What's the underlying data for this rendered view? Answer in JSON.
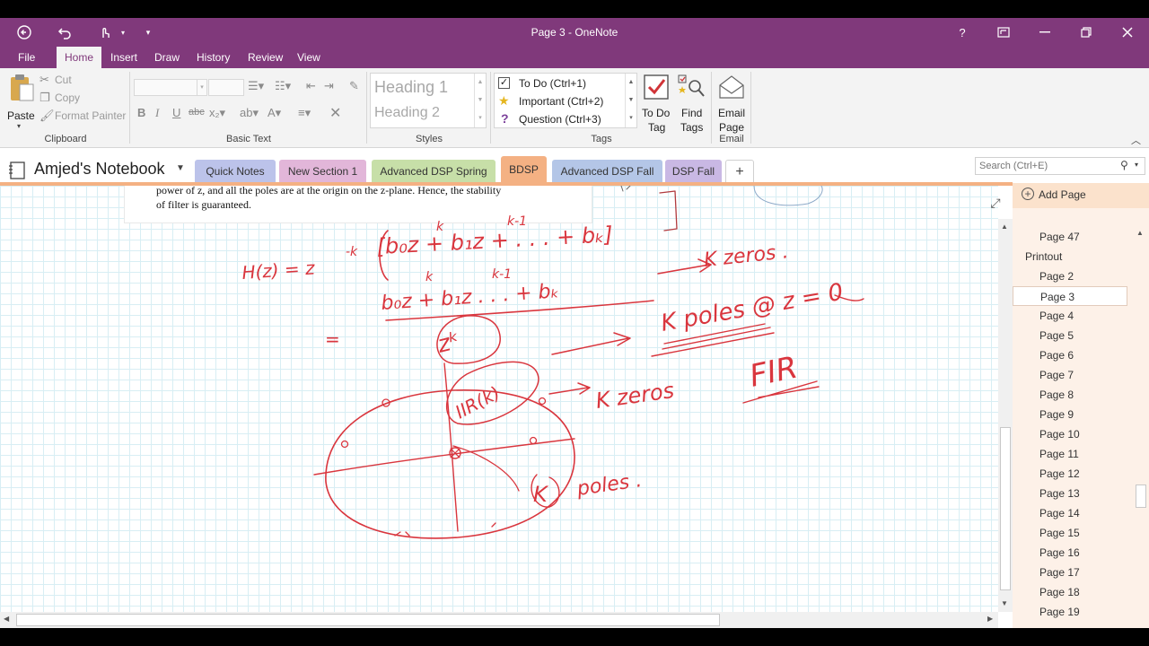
{
  "window": {
    "title": "Page 3 - OneNote",
    "help": "?"
  },
  "menu": {
    "tabs": [
      "File",
      "Home",
      "Insert",
      "Draw",
      "History",
      "Review",
      "View"
    ],
    "active": "Home"
  },
  "ribbon": {
    "clipboard": {
      "paste": "Paste",
      "cut": "Cut",
      "copy": "Copy",
      "format_painter": "Format Painter",
      "label": "Clipboard"
    },
    "basic_text": {
      "label": "Basic Text"
    },
    "styles": {
      "heading1": "Heading 1",
      "heading2": "Heading 2",
      "label": "Styles"
    },
    "tags": {
      "items": [
        "To Do (Ctrl+1)",
        "Important (Ctrl+2)",
        "Question (Ctrl+3)"
      ],
      "todo_tag_line1": "To Do",
      "todo_tag_line2": "Tag",
      "find_tags_line1": "Find",
      "find_tags_line2": "Tags",
      "label": "Tags"
    },
    "email": {
      "line1": "Email",
      "line2": "Page",
      "label": "Email"
    }
  },
  "notebook": {
    "name": "Amjed's Notebook",
    "sections": [
      {
        "label": "Quick Notes",
        "color": "#bcc3ea"
      },
      {
        "label": "New Section 1",
        "color": "#e2b6d9"
      },
      {
        "label": "Advanced DSP Spring",
        "color": "#c7dfa8"
      },
      {
        "label": "BDSP",
        "color": "#f4b183"
      },
      {
        "label": "Advanced DSP Fall",
        "color": "#b4c6e7"
      },
      {
        "label": "DSP Fall",
        "color": "#c9b8e4"
      }
    ],
    "add_section": "+",
    "search_placeholder": "Search (Ctrl+E)"
  },
  "document": {
    "line1": "power of z, and all the poles are at the origin on the z-plane. Hence, the stability",
    "line2": "of filter is guaranteed."
  },
  "pages": {
    "add_page": "Add Page",
    "items": [
      {
        "label": "Page 47",
        "level": 2
      },
      {
        "label": "Printout",
        "level": 1
      },
      {
        "label": "Page 2",
        "level": 2
      },
      {
        "label": "Page 3",
        "level": 2,
        "selected": true
      },
      {
        "label": "Page 4",
        "level": 2
      },
      {
        "label": "Page 5",
        "level": 2
      },
      {
        "label": "Page 6",
        "level": 2
      },
      {
        "label": "Page 7",
        "level": 2
      },
      {
        "label": "Page 8",
        "level": 2
      },
      {
        "label": "Page 9",
        "level": 2
      },
      {
        "label": "Page 10",
        "level": 2
      },
      {
        "label": "Page 11",
        "level": 2
      },
      {
        "label": "Page 12",
        "level": 2
      },
      {
        "label": "Page 13",
        "level": 2
      },
      {
        "label": "Page 14",
        "level": 2
      },
      {
        "label": "Page 15",
        "level": 2
      },
      {
        "label": "Page 16",
        "level": 2
      },
      {
        "label": "Page 17",
        "level": 2
      },
      {
        "label": "Page 18",
        "level": 2
      },
      {
        "label": "Page 19",
        "level": 2
      }
    ]
  },
  "ink": {
    "color": "#d9363e",
    "texts": {
      "hz": "H(z) = z",
      "neg_k": "-k",
      "top_num": "[b₀z  + b₁z     + . . . + bₖ]",
      "k_sup": "k",
      "km1_sup": "k-1",
      "k_zeros": "K zeros .",
      "bottom_num": "b₀z  + b₁z     . . . + bₖ",
      "zk": "zᵏ",
      "eq": "=",
      "k_poles": "K poles @ z = 0",
      "iir": "IIR(k)",
      "k_zeros2": "K zeros",
      "fir": "FIR",
      "k_poles2": "K",
      "poles": "poles ."
    }
  }
}
